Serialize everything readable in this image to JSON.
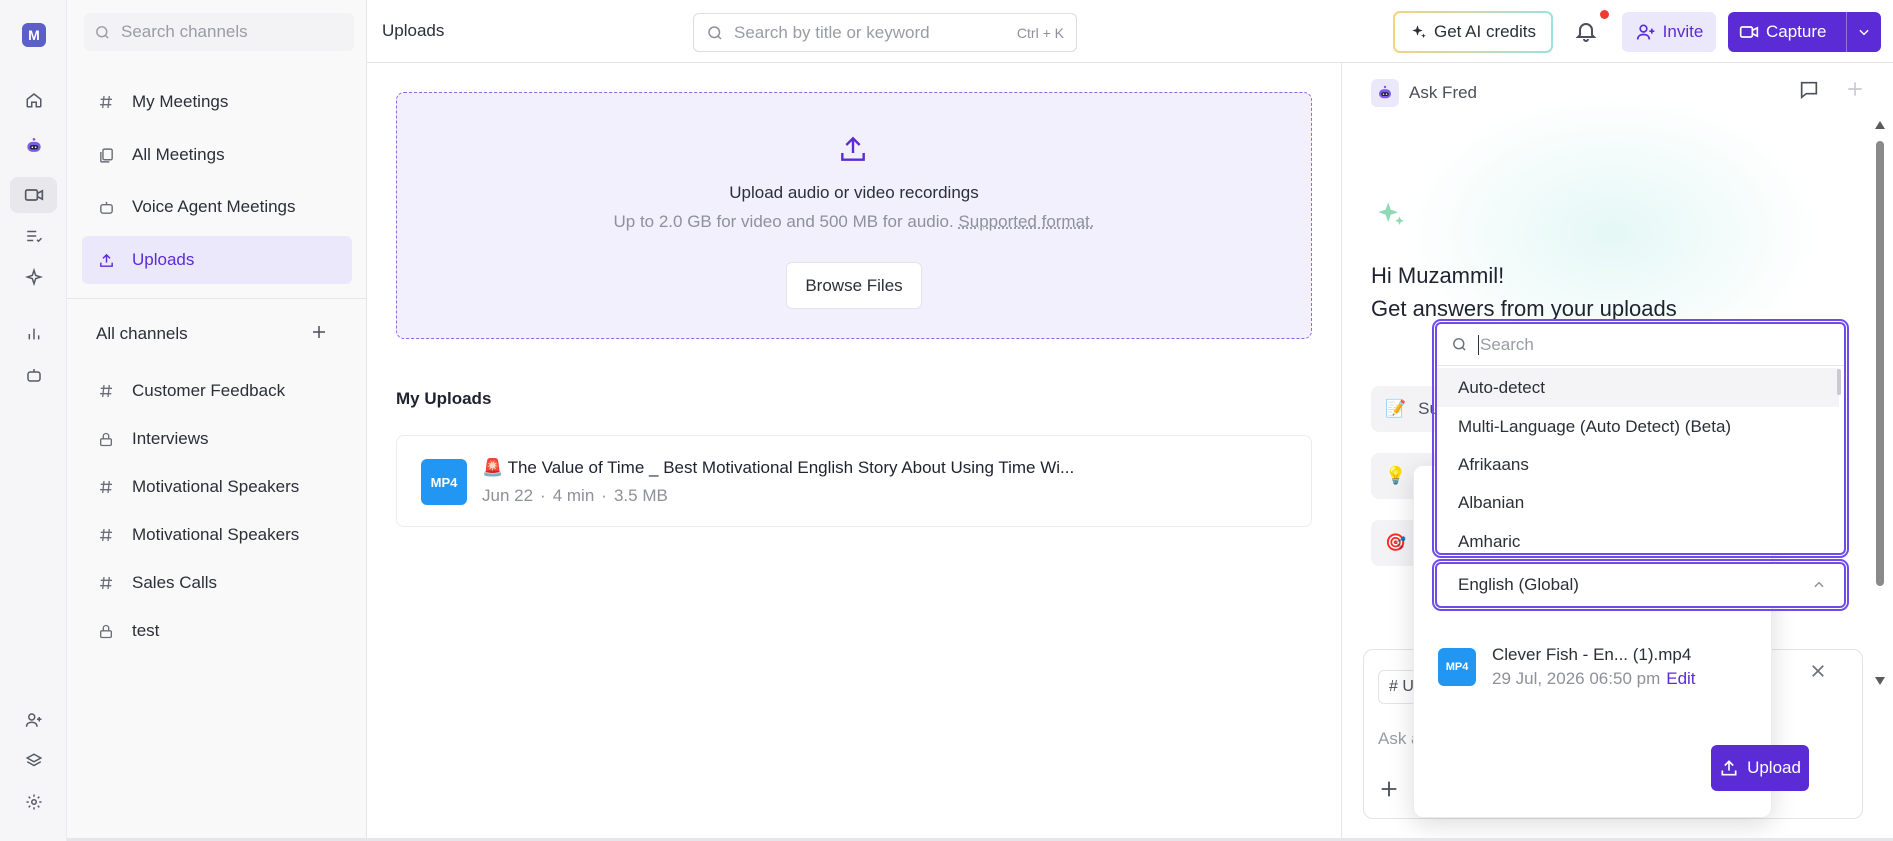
{
  "rail": {
    "avatar_initial": "M",
    "icons": [
      "home-icon",
      "fred-bot-icon",
      "video-icon",
      "tasks-icon",
      "sparkle-icon",
      "analytics-icon",
      "voice-agent-icon",
      "add-user-icon",
      "layers-icon",
      "settings-icon"
    ]
  },
  "sidebar": {
    "search_placeholder": "Search channels",
    "items": [
      {
        "label": "My Meetings",
        "icon": "hash-icon"
      },
      {
        "label": "All Meetings",
        "icon": "meetings-icon"
      },
      {
        "label": "Voice Agent Meetings",
        "icon": "voice-agent-icon"
      },
      {
        "label": "Uploads",
        "icon": "upload-icon",
        "active": true
      }
    ],
    "all_channels_label": "All channels",
    "channels": [
      {
        "label": "Customer Feedback",
        "icon": "hash-icon"
      },
      {
        "label": "Interviews",
        "icon": "lock-icon"
      },
      {
        "label": "Motivational Speakers",
        "icon": "hash-icon"
      },
      {
        "label": "Motivational Speakers",
        "icon": "hash-icon"
      },
      {
        "label": "Sales Calls",
        "icon": "hash-icon"
      },
      {
        "label": "test",
        "icon": "lock-icon"
      }
    ]
  },
  "topbar": {
    "title": "Uploads",
    "search_placeholder": "Search by title or keyword",
    "search_shortcut": "Ctrl + K",
    "ai_credits_label": "Get AI credits",
    "invite_label": "Invite",
    "capture_label": "Capture"
  },
  "main": {
    "upload_title": "Upload audio or video recordings",
    "upload_sub": "Up to 2.0 GB for video and 500 MB for audio.",
    "upload_sub_link": "Supported format.",
    "browse_label": "Browse Files",
    "my_uploads_heading": "My Uploads",
    "uploads": [
      {
        "badge": "MP4",
        "emoji": "🚨",
        "title": "The Value of Time _ Best Motivational English Story About Using Time Wi...",
        "date": "Jun 22",
        "duration": "4 min",
        "size": "3.5 MB"
      }
    ]
  },
  "right_panel": {
    "title": "Ask Fred",
    "greeting": "Hi Muzammil!",
    "subtitle": "Get answers from your uploads",
    "chips": [
      {
        "emoji": "📝",
        "label": "Su"
      },
      {
        "emoji": "💡",
        "label": ""
      },
      {
        "emoji": "🎯",
        "label": ""
      }
    ],
    "input_tag": "# U",
    "input_placeholder": "Ask a"
  },
  "popover": {
    "file_badge": "MP4",
    "file_name": "Clever Fish - En... (1).mp4",
    "file_date": "29 Jul, 2026 06:50 pm",
    "edit_label": "Edit",
    "upload_label": "Upload"
  },
  "language": {
    "selected": "English (Global)",
    "search_placeholder": "Search",
    "options": [
      "Auto-detect",
      "Multi-Language (Auto Detect) (Beta)",
      "Afrikaans",
      "Albanian",
      "Amharic"
    ]
  },
  "colors": {
    "accent": "#5b2bd6",
    "accent_light": "#ece8fc",
    "focus_ring": "#6f4be8",
    "mp4_badge": "#2196f3",
    "notification_dot": "#ef3b34"
  }
}
